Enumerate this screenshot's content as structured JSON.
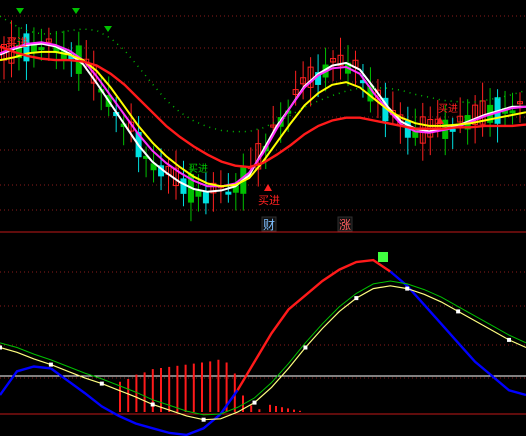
{
  "colors": {
    "background": "#000000",
    "grid": "#8b1c1c",
    "divider": "#c01818",
    "candle_up": "#ff2020",
    "candle_down": "#00e0e0",
    "candle_down_alt": "#00c000",
    "ma_white": "#ffffff",
    "ma_magenta": "#ff30ff",
    "ma_yellow": "#ffff00",
    "ma_red": "#ff1a1a",
    "ma_dots": "#00c000",
    "signal_buy": "#ff2020",
    "signal_sell": "#00c000",
    "macd_line": "#ff1a1a",
    "macd_line_low": "#0000ff",
    "signal_line_mid": "#ffff80",
    "signal_line_tail": "#00c000",
    "hist_up": "#ff1a1a",
    "hist_marker": "#40ff40",
    "baseline": "#ffffff"
  },
  "labels": {
    "buy_text": "买进",
    "tag_cai": "财",
    "tag_zhang": "涨"
  },
  "chart_data": [
    {
      "type": "candlestick",
      "role": "main-price-panel",
      "series": [
        {
          "name": "",
          "color_key": "ma_white",
          "values": [
            34,
            30,
            27,
            26,
            28,
            33,
            41,
            55,
            70,
            85,
            100,
            112,
            120,
            127,
            132,
            134,
            133,
            130,
            122,
            104,
            86,
            72,
            57,
            48,
            42,
            40,
            45,
            58,
            72,
            83,
            88,
            90,
            88,
            86,
            82,
            78,
            75,
            72,
            72
          ]
        },
        {
          "name": "",
          "color_key": "ma_magenta",
          "values": [
            33,
            29,
            26,
            25,
            27,
            31,
            38,
            50,
            64,
            78,
            92,
            104,
            113,
            120,
            126,
            130,
            130,
            128,
            120,
            106,
            88,
            72,
            58,
            49,
            44,
            43,
            48,
            62,
            74,
            85,
            90,
            91,
            89,
            87,
            83,
            79,
            76,
            73,
            72
          ]
        },
        {
          "name": "",
          "color_key": "ma_yellow",
          "values": [
            38,
            36,
            33,
            32,
            32,
            34,
            38,
            46,
            58,
            72,
            86,
            98,
            108,
            116,
            123,
            128,
            130,
            129,
            124,
            112,
            98,
            84,
            71,
            62,
            56,
            54,
            58,
            66,
            74,
            80,
            84,
            86,
            86,
            85,
            84,
            82,
            80,
            78,
            76
          ]
        },
        {
          "name": "",
          "color_key": "ma_red",
          "values": [
            28,
            32,
            35,
            37,
            38,
            38,
            39,
            42,
            48,
            56,
            66,
            76,
            86,
            94,
            101,
            107,
            112,
            115,
            116,
            113,
            107,
            100,
            92,
            86,
            82,
            80,
            80,
            82,
            84,
            86,
            88,
            88,
            88,
            87,
            87,
            86,
            86,
            86,
            85
          ]
        }
      ],
      "signals": [
        {
          "kind": "buy",
          "label": "买进",
          "at": "left-top"
        },
        {
          "kind": "buy",
          "label": "买进",
          "at": "bottom-low"
        },
        {
          "kind": "sell",
          "at": "top-left"
        },
        {
          "kind": "sell",
          "at": "top-mid"
        },
        {
          "kind": "buy-arrow",
          "at": "bottom-low"
        },
        {
          "kind": "buy-arrow",
          "at": "right"
        }
      ]
    },
    {
      "type": "line",
      "role": "macd-indicator-panel",
      "series": [
        {
          "name": "",
          "color_key": "macd_line",
          "values": [
            -0.2,
            0.05,
            0.1,
            0.08,
            -0.05,
            -0.18,
            -0.32,
            -0.42,
            -0.5,
            -0.55,
            -0.6,
            -0.62,
            -0.55,
            -0.4,
            -0.15,
            0.15,
            0.45,
            0.7,
            0.85,
            1.0,
            1.12,
            1.2,
            1.22,
            1.1,
            0.95,
            0.75,
            0.55,
            0.35,
            0.15,
            0.0,
            -0.15,
            -0.2
          ]
        },
        {
          "name": "",
          "color_key": "signal_line_mid",
          "values": [
            0.3,
            0.25,
            0.18,
            0.12,
            0.05,
            -0.02,
            -0.08,
            -0.15,
            -0.22,
            -0.3,
            -0.36,
            -0.42,
            -0.46,
            -0.45,
            -0.38,
            -0.28,
            -0.12,
            0.08,
            0.3,
            0.5,
            0.68,
            0.82,
            0.92,
            0.95,
            0.92,
            0.86,
            0.78,
            0.68,
            0.58,
            0.48,
            0.38,
            0.3
          ]
        },
        {
          "name": "",
          "color_key": "hist_up",
          "bars": [
            0.55,
            0.6,
            0.68,
            0.72,
            0.78,
            0.8,
            0.82,
            0.84,
            0.86,
            0.88,
            0.9,
            0.92,
            0.95,
            0.9,
            0.7,
            0.3,
            0.12,
            0.05
          ]
        }
      ]
    }
  ]
}
